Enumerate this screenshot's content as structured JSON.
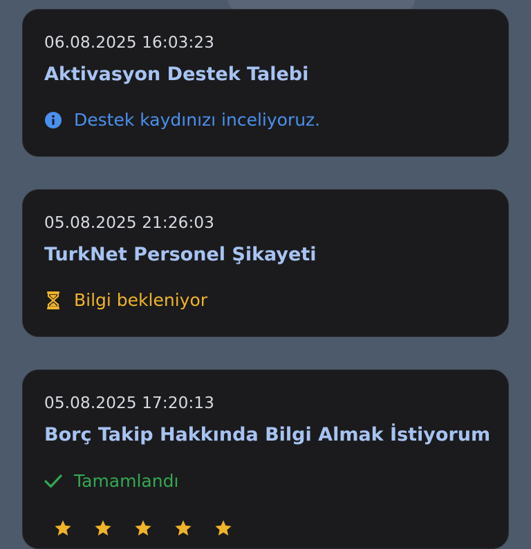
{
  "tickets": [
    {
      "date": "06.08.2025 16:03:23",
      "title": "Aktivasyon Destek Talebi",
      "status": "Destek kaydınızı inceliyoruz.",
      "status_icon": "info-icon",
      "status_color": "#4a90ee"
    },
    {
      "date": "05.08.2025 21:26:03",
      "title": "TurkNet Personel Şikayeti",
      "status": "Bilgi bekleniyor",
      "status_icon": "hourglass-icon",
      "status_color": "#f0b429"
    },
    {
      "date": "05.08.2025 17:20:13",
      "title": "Borç Takip Hakkında Bilgi Almak İstiyorum",
      "status": "Tamamlandı",
      "status_icon": "checkmark-icon",
      "status_color": "#34a853",
      "rating_icon": "star-icon",
      "rating_color": "#f0b429"
    }
  ]
}
